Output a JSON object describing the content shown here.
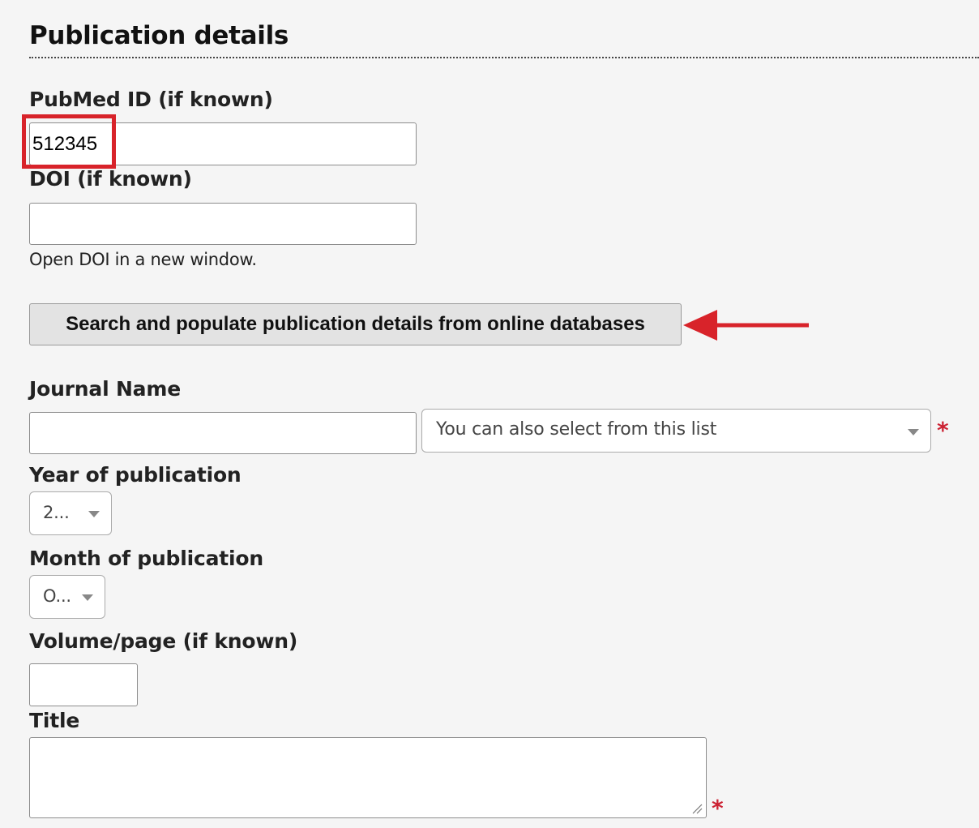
{
  "section": {
    "title": "Publication details"
  },
  "pubmed": {
    "label": "PubMed ID (if known)",
    "value": "512345"
  },
  "doi": {
    "label": "DOI (if known)",
    "value": "",
    "link_text": "Open DOI in a new window."
  },
  "search_button": {
    "label": "Search and populate publication details from online databases"
  },
  "journal": {
    "label": "Journal Name",
    "value": "",
    "select_placeholder": "You can also select from this list",
    "required_mark": "*"
  },
  "year": {
    "label": "Year of publication",
    "selected": "2..."
  },
  "month": {
    "label": "Month of publication",
    "selected": "O..."
  },
  "volume": {
    "label": "Volume/page (if known)",
    "value": ""
  },
  "title_field": {
    "label": "Title",
    "value": "",
    "required_mark": "*"
  },
  "colors": {
    "annotation_red": "#d8232a",
    "required_red": "#cc2233",
    "page_background": "#f5f5f5"
  },
  "icons": [
    "chevron-down-icon",
    "arrow-left-icon",
    "resize-grip-icon"
  ]
}
